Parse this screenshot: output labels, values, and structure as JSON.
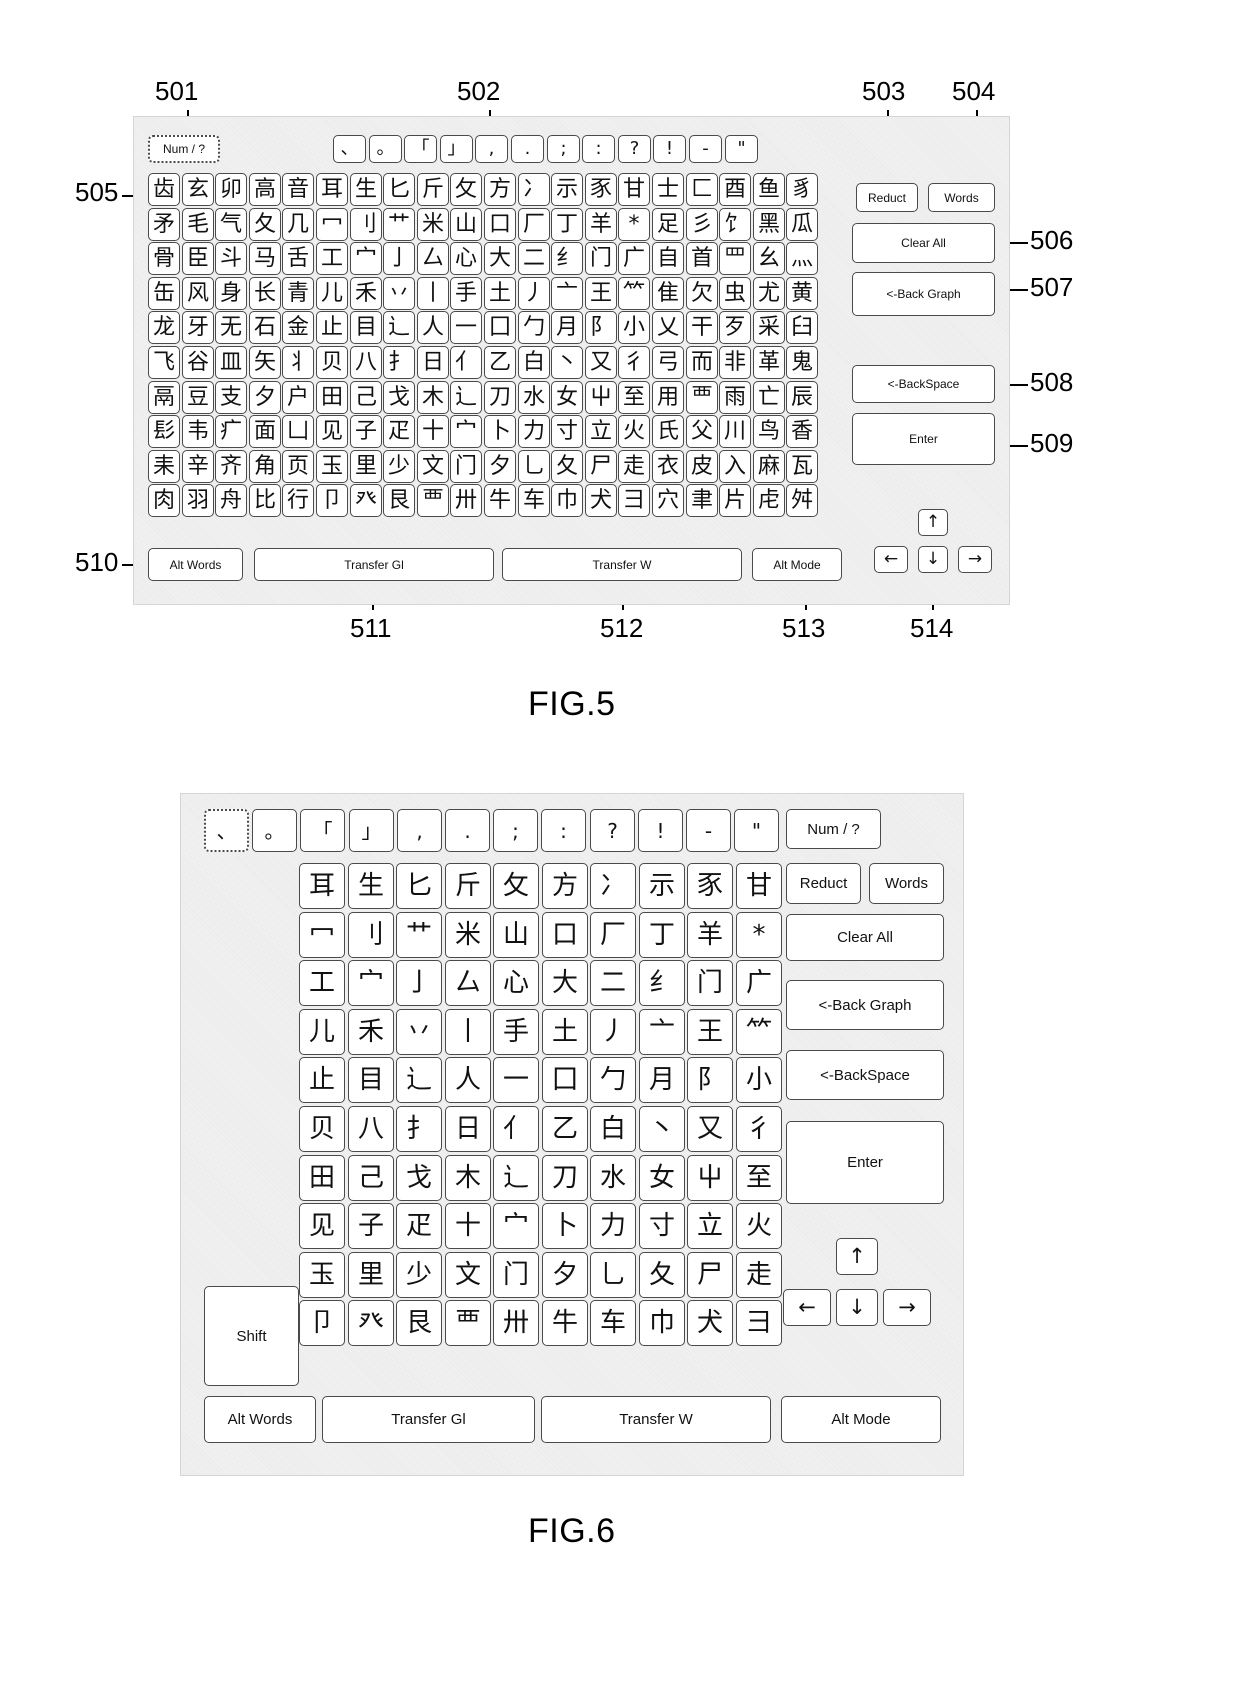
{
  "figures": [
    {
      "id": "fig5",
      "caption": "FIG.5"
    },
    {
      "id": "fig6",
      "caption": "FIG.6"
    }
  ],
  "fig5": {
    "caption": "FIG.5",
    "callouts": [
      {
        "num": "501",
        "target": "num-symbol-key"
      },
      {
        "num": "502",
        "target": "punctuation-row"
      },
      {
        "num": "503",
        "target": "reduct-button"
      },
      {
        "num": "504",
        "target": "words-button"
      },
      {
        "num": "505",
        "target": "radical-grid"
      },
      {
        "num": "506",
        "target": "clear-all-button"
      },
      {
        "num": "507",
        "target": "back-graph-button"
      },
      {
        "num": "508",
        "target": "backspace-button"
      },
      {
        "num": "509",
        "target": "enter-button"
      },
      {
        "num": "510",
        "target": "alt-words-button"
      },
      {
        "num": "511",
        "target": "transfer-gl-button"
      },
      {
        "num": "512",
        "target": "transfer-w-button"
      },
      {
        "num": "513",
        "target": "alt-mode-button"
      },
      {
        "num": "514",
        "target": "arrow-keys"
      }
    ],
    "num_key": "Num / ?",
    "punctuation": [
      "、",
      "。",
      "「",
      "」",
      ",",
      ".",
      ";",
      ":",
      "?",
      "!",
      "-",
      "\""
    ],
    "grid": [
      [
        "齿",
        "玄",
        "卯",
        "高",
        "音",
        "耳",
        "生",
        "匕",
        "斤",
        "攵",
        "方",
        "冫",
        "示",
        "豕",
        "甘",
        "士",
        "匚",
        "酉",
        "鱼",
        "豸"
      ],
      [
        "矛",
        "毛",
        "气",
        "夂",
        "几",
        "冖",
        "刂",
        "艹",
        "米",
        "山",
        "口",
        "厂",
        "丁",
        "羊",
        "*",
        "足",
        "彡",
        "饣",
        "黑",
        "瓜"
      ],
      [
        "骨",
        "臣",
        "斗",
        "马",
        "舌",
        "工",
        "宀",
        "亅",
        "厶",
        "心",
        "大",
        "二",
        "纟",
        "门",
        "广",
        "自",
        "首",
        "罒",
        "幺",
        "灬"
      ],
      [
        "缶",
        "风",
        "身",
        "长",
        "青",
        "儿",
        "禾",
        "丷",
        "丨",
        "手",
        "土",
        "丿",
        "亠",
        "王",
        "𥫗",
        "隹",
        "欠",
        "虫",
        "尤",
        "黄"
      ],
      [
        "龙",
        "牙",
        "无",
        "石",
        "金",
        "止",
        "目",
        "辶",
        "人",
        "一",
        "囗",
        "勹",
        "月",
        "阝",
        "小",
        "乂",
        "干",
        "歹",
        "采",
        "臼"
      ],
      [
        "飞",
        "谷",
        "皿",
        "矢",
        "丬",
        "贝",
        "八",
        "扌",
        "日",
        "亻",
        "乙",
        "白",
        "丶",
        "又",
        "彳",
        "弓",
        "而",
        "非",
        "革",
        "鬼"
      ],
      [
        "鬲",
        "豆",
        "支",
        "夕",
        "户",
        "田",
        "己",
        "戈",
        "木",
        "辶",
        "刀",
        "水",
        "女",
        "屮",
        "至",
        "用",
        "覀",
        "雨",
        "亡",
        "辰"
      ],
      [
        "髟",
        "韦",
        "疒",
        "面",
        "凵",
        "见",
        "子",
        "疋",
        "十",
        "宀",
        "卜",
        "力",
        "寸",
        "立",
        "火",
        "氏",
        "父",
        "川",
        "鸟",
        "香"
      ],
      [
        "耒",
        "辛",
        "齐",
        "角",
        "页",
        "玉",
        "里",
        "少",
        "文",
        "门",
        "夕",
        "乚",
        "夂",
        "尸",
        "走",
        "衣",
        "皮",
        "入",
        "麻",
        "瓦"
      ],
      [
        "肉",
        "羽",
        "舟",
        "比",
        "行",
        "卩",
        "癶",
        "艮",
        "覀",
        "卅",
        "牛",
        "车",
        "巾",
        "犬",
        "彐",
        "穴",
        "聿",
        "片",
        "虍",
        "舛"
      ]
    ],
    "right_buttons": {
      "reduct": "Reduct",
      "words": "Words",
      "clear_all": "Clear All",
      "back_graph": "<-Back Graph",
      "backspace": "<-BackSpace",
      "enter": "Enter"
    },
    "arrows": {
      "up": "↑",
      "left": "←",
      "down": "↓",
      "right": "→"
    },
    "bottom_buttons": {
      "alt_words": "Alt Words",
      "transfer_gl": "Transfer Gl",
      "transfer_w": "Transfer W",
      "alt_mode": "Alt Mode"
    }
  },
  "fig6": {
    "caption": "FIG.6",
    "num_key": "Num / ?",
    "punctuation": [
      "、",
      "。",
      "「",
      "」",
      ",",
      ".",
      ";",
      ":",
      "?",
      "!",
      "-",
      "\""
    ],
    "grid": [
      [
        "耳",
        "生",
        "匕",
        "斤",
        "攵",
        "方",
        "冫",
        "示",
        "豕",
        "甘"
      ],
      [
        "冖",
        "刂",
        "艹",
        "米",
        "山",
        "口",
        "厂",
        "丁",
        "羊",
        "*"
      ],
      [
        "工",
        "宀",
        "亅",
        "厶",
        "心",
        "大",
        "二",
        "纟",
        "门",
        "广"
      ],
      [
        "儿",
        "禾",
        "丷",
        "丨",
        "手",
        "土",
        "丿",
        "亠",
        "王",
        "𥫗"
      ],
      [
        "止",
        "目",
        "辶",
        "人",
        "一",
        "囗",
        "勹",
        "月",
        "阝",
        "小"
      ],
      [
        "贝",
        "八",
        "扌",
        "日",
        "亻",
        "乙",
        "白",
        "丶",
        "又",
        "彳"
      ],
      [
        "田",
        "己",
        "戈",
        "木",
        "辶",
        "刀",
        "水",
        "女",
        "屮",
        "至"
      ],
      [
        "见",
        "子",
        "疋",
        "十",
        "宀",
        "卜",
        "力",
        "寸",
        "立",
        "火"
      ],
      [
        "玉",
        "里",
        "少",
        "文",
        "门",
        "夕",
        "乚",
        "夂",
        "尸",
        "走"
      ],
      [
        "卩",
        "癶",
        "艮",
        "覀",
        "卅",
        "牛",
        "车",
        "巾",
        "犬",
        "彐"
      ]
    ],
    "shift": "Shift",
    "right_buttons": {
      "reduct": "Reduct",
      "words": "Words",
      "clear_all": "Clear All",
      "back_graph": "<-Back Graph",
      "backspace": "<-BackSpace",
      "enter": "Enter"
    },
    "arrows": {
      "up": "↑",
      "left": "←",
      "down": "↓",
      "right": "→"
    },
    "bottom_buttons": {
      "alt_words": "Alt Words",
      "transfer_gl": "Transfer Gl",
      "transfer_w": "Transfer W",
      "alt_mode": "Alt Mode"
    }
  }
}
